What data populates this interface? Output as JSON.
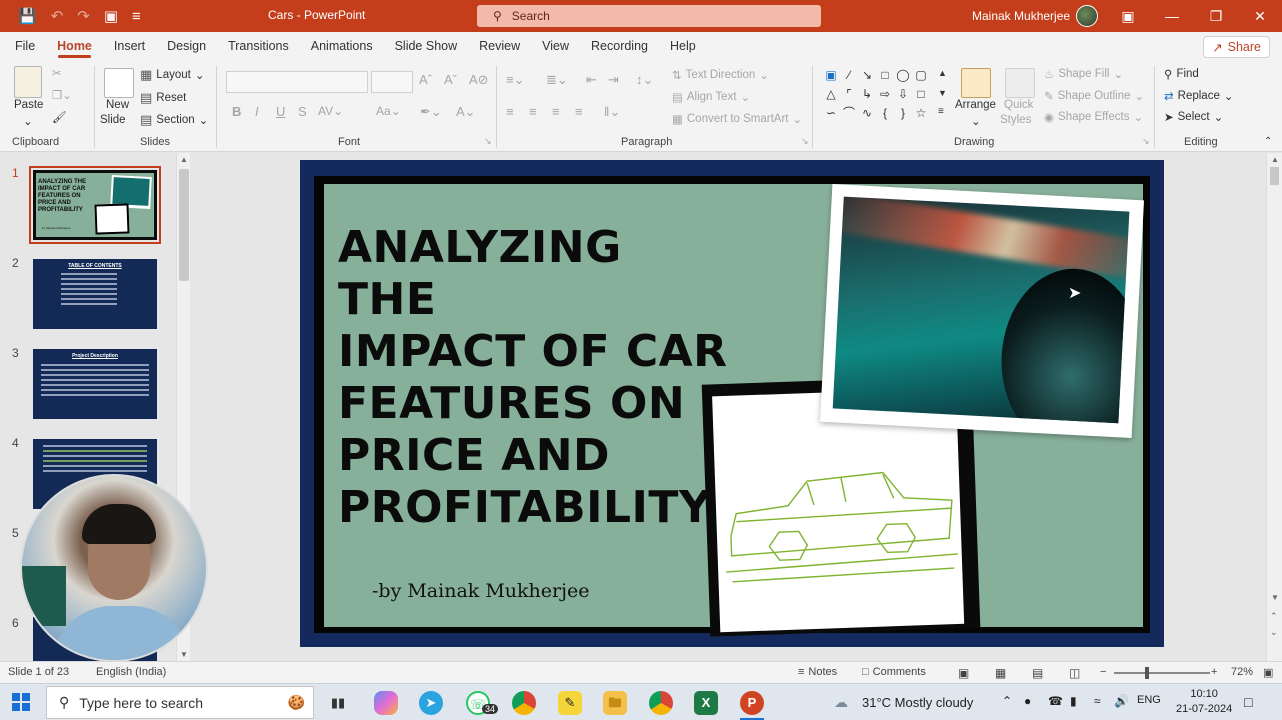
{
  "titlebar": {
    "doc_title": "Cars  -  PowerPoint",
    "search_placeholder": "Search",
    "user_name": "Mainak Mukherjee"
  },
  "tabs": [
    "File",
    "Home",
    "Insert",
    "Design",
    "Transitions",
    "Animations",
    "Slide Show",
    "Review",
    "View",
    "Recording",
    "Help"
  ],
  "active_tab": "Home",
  "share_label": "Share",
  "ribbon": {
    "clipboard": {
      "label": "Clipboard",
      "paste": "Paste"
    },
    "slides": {
      "label": "Slides",
      "new_slide": "New",
      "new_slide2": "Slide",
      "layout": "Layout",
      "reset": "Reset",
      "section": "Section"
    },
    "font": {
      "label": "Font"
    },
    "paragraph": {
      "label": "Paragraph",
      "text_direction": "Text Direction",
      "align_text": "Align Text",
      "convert_smartart": "Convert to SmartArt"
    },
    "drawing": {
      "label": "Drawing",
      "arrange": "Arrange",
      "quick_styles": "Quick",
      "quick_styles2": "Styles",
      "shape_fill": "Shape Fill",
      "shape_outline": "Shape Outline",
      "shape_effects": "Shape Effects"
    },
    "editing": {
      "label": "Editing",
      "find": "Find",
      "replace": "Replace",
      "select": "Select"
    }
  },
  "thumbnails": [
    {
      "num": "1",
      "title": "ANALYZING THE IMPACT OF CAR FEATURES ON PRICE AND PROFITABILITY"
    },
    {
      "num": "2",
      "title": "TABLE OF CONTENTS"
    },
    {
      "num": "3",
      "title": "Project Description"
    },
    {
      "num": "4",
      "title": ""
    },
    {
      "num": "5",
      "title": ""
    },
    {
      "num": "6",
      "title": ""
    }
  ],
  "slide": {
    "title_lines": [
      "ANALYZING THE",
      "IMPACT OF CAR",
      "FEATURES ON",
      "PRICE AND",
      "PROFITABILITY"
    ],
    "author": "-by Mainak Mukherjee"
  },
  "statusbar": {
    "slide_of": "Slide 1 of 23",
    "language": "English (India)",
    "notes": "Notes",
    "comments": "Comments",
    "zoom": "72%"
  },
  "taskbar": {
    "search_placeholder": "Type here to search",
    "whatsapp_badge": "34",
    "weather": "31°C  Mostly cloudy",
    "lang": "ENG",
    "time": "10:10",
    "date": "21-07-2024"
  },
  "colors": {
    "accent": "#c43e1c",
    "slide_bg": "#87b09a",
    "slide_border": "#152a5c"
  }
}
